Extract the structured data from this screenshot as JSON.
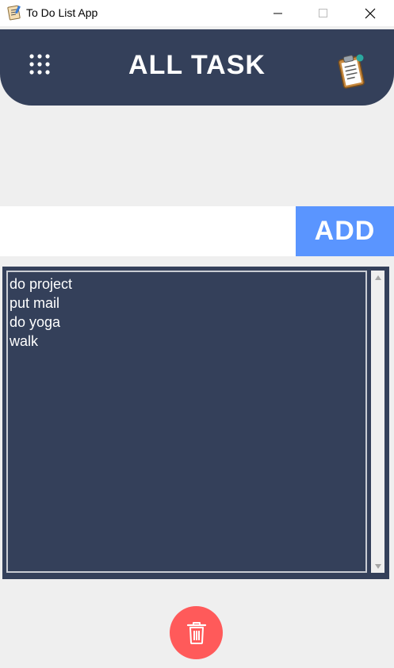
{
  "window": {
    "title": "To Do List App"
  },
  "header": {
    "title": "ALL TASK",
    "menu_icon": "dots-grid-icon",
    "logo_icon": "clipboard-icon"
  },
  "input": {
    "value": "",
    "placeholder": ""
  },
  "add_button": {
    "label": "ADD"
  },
  "tasks": [
    "do project",
    "put mail",
    "do yoga",
    "walk"
  ],
  "delete_button": {
    "icon": "trash-icon"
  },
  "colors": {
    "header_bg": "#34405a",
    "add_button_bg": "#5a95ff",
    "delete_button_bg": "#ff5a5a",
    "page_bg": "#efefef"
  }
}
